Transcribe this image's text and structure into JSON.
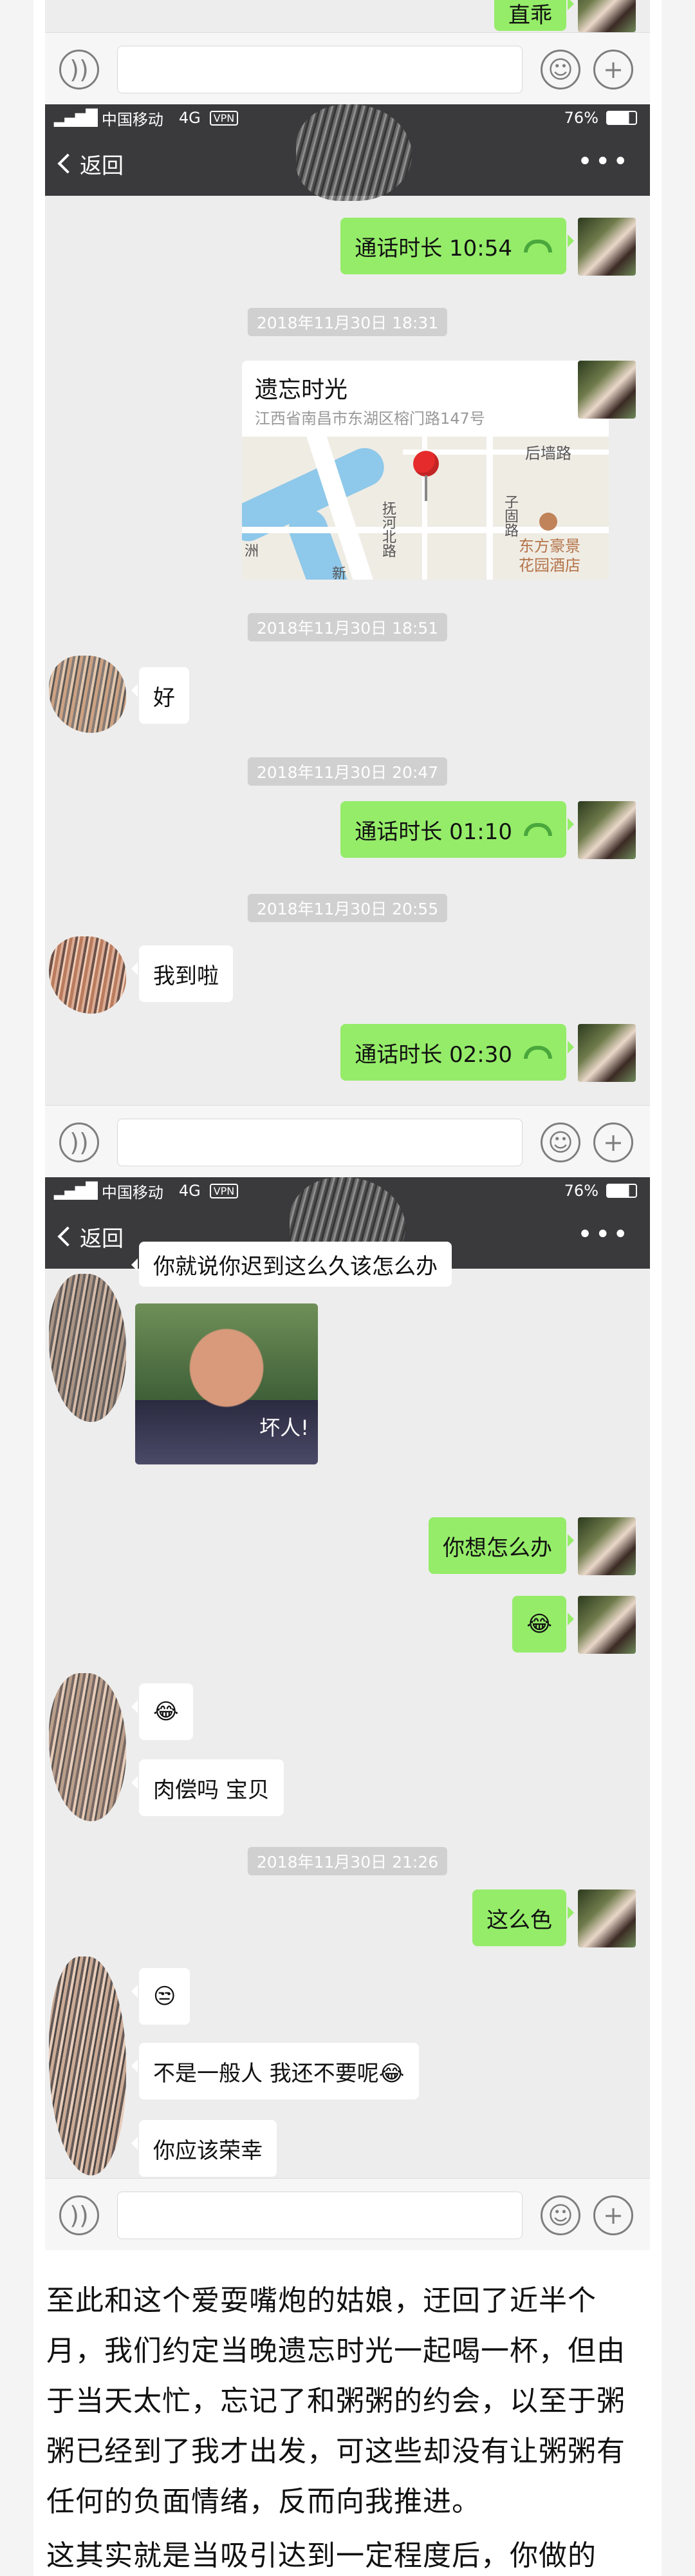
{
  "screenshot1": {
    "bubble_top": "直乖"
  },
  "screenshot2": {
    "status": {
      "carrier": "中国移动",
      "network": "4G",
      "vpn": "VPN",
      "battery": "76%"
    },
    "nav": {
      "back": "返回"
    },
    "messages": {
      "call1": "通话时长 10:54",
      "time1": "2018年11月30日 18:31",
      "location_title": "遗忘时光",
      "location_addr": "江西省南昌市东湖区榕门路147号",
      "map_labels": [
        "后墙路",
        "子固路",
        "抚河北路",
        "东方豪景",
        "花园酒店",
        "新",
        "洲"
      ],
      "time2": "2018年11月30日 18:51",
      "reply1": "好",
      "time3": "2018年11月30日 20:47",
      "call2": "通话时长 01:10",
      "time4": "2018年11月30日 20:55",
      "reply2": "我到啦",
      "call3": "通话时长 02:30"
    }
  },
  "screenshot3": {
    "status": {
      "carrier": "中国移动",
      "network": "4G",
      "vpn": "VPN",
      "battery": "76%"
    },
    "nav": {
      "back": "返回"
    },
    "messages": {
      "cut": "你就说你迟到这么久该怎么办",
      "sticker_caption": "坏人!",
      "me1": "你想怎么办",
      "me_emoji": "😂",
      "her_emoji": "😂",
      "her1": "肉偿吗 宝贝",
      "time1": "2018年11月30日 21:26",
      "me2": "这么色",
      "her_emoji2": "😒",
      "her2": "不是一般人 我还不要呢😂",
      "her3": "你应该荣幸"
    }
  },
  "article": {
    "p1": "至此和这个爱耍嘴炮的姑娘，迂回了近半个月，我们约定当晚遗忘时光一起喝一杯，但由于当天太忙，忘记了和粥粥的约会，以至于粥粥已经到了我才出发，可这些却没有让粥粥有任何的负面情绪，反而向我推进。",
    "p2": "这其实就是当吸引达到一定程度后，你做的"
  }
}
